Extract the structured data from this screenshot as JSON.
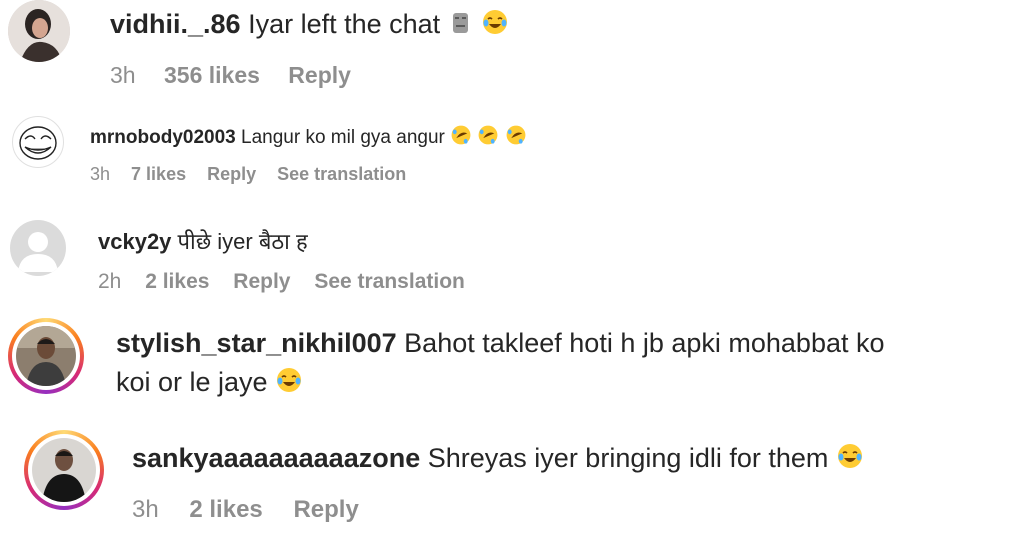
{
  "comments": [
    {
      "username": "vidhii._.86",
      "text": "Iyar left the chat",
      "emojis": [
        "stone-face-emoji",
        "tears-of-joy-emoji"
      ],
      "time": "3h",
      "likes": "356 likes",
      "reply": "Reply"
    },
    {
      "username": "mrnobody02003",
      "text": "Langur ko mil gya angur",
      "emojis": [
        "rolling-on-floor-laughing-emoji",
        "rolling-on-floor-laughing-emoji",
        "rolling-on-floor-laughing-emoji"
      ],
      "time": "3h",
      "likes": "7 likes",
      "reply": "Reply",
      "translation": "See translation"
    },
    {
      "username": "vcky2y",
      "text": "पीछे iyer बैठा ह",
      "time": "2h",
      "likes": "2 likes",
      "reply": "Reply",
      "translation": "See translation"
    },
    {
      "username": "stylish_star_nikhil007",
      "text_line1": "Bahot takleef hoti h jb apki mohabbat ko",
      "text_line2": "koi or le jaye",
      "emojis": [
        "tears-of-joy-emoji"
      ]
    },
    {
      "username": "sankyaaaaaaaaaazone",
      "text": "Shreyas iyer bringing idli for them",
      "emojis": [
        "tears-of-joy-emoji"
      ],
      "time": "3h",
      "likes": "2 likes",
      "reply": "Reply"
    }
  ],
  "colors": {
    "text": "#262626",
    "meta": "#8e8e8e",
    "story_ring": [
      "#feda75",
      "#fa7e1e",
      "#d62976",
      "#962fbf"
    ]
  }
}
